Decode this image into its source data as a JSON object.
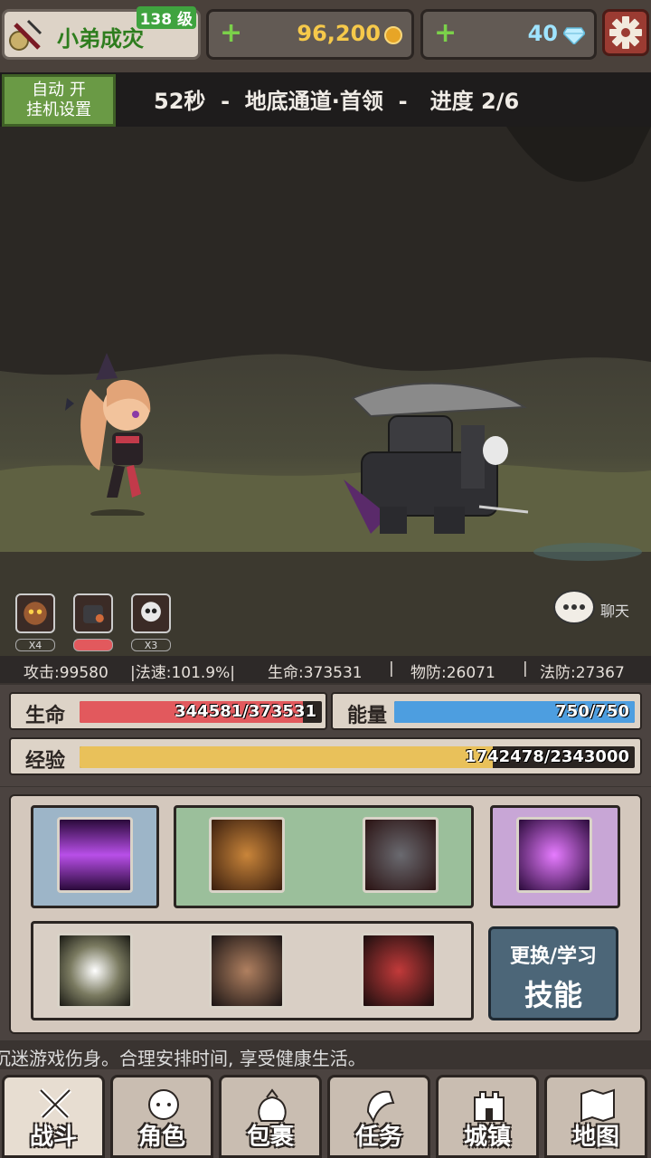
{
  "player": {
    "name": "小弟成灾",
    "level": "138 级"
  },
  "currency": {
    "gold": "96,200",
    "gems": "40",
    "plus_symbol": "+"
  },
  "auto_button": {
    "line1": "自动 开",
    "line2": "挂机设置"
  },
  "stage": {
    "text": "52秒  -  地底通道·首领  -   进度 2/6"
  },
  "enemies": [
    {
      "count": "X4"
    },
    {
      "count": ""
    },
    {
      "count": "X3"
    }
  ],
  "chat": {
    "label": "聊天"
  },
  "stats": {
    "attack": "攻击:99580",
    "cast_speed": "|法速:101.9%|",
    "hp": "生命:373531",
    "sep1": "|",
    "phys_def": "物防:26071",
    "sep2": "|",
    "mag_def": "法防:27367"
  },
  "bars": {
    "hp": {
      "label": "生命",
      "text": "344581/373531",
      "fraction": 0.9225,
      "color": "#e2595d"
    },
    "energy": {
      "label": "能量",
      "text": "750/750",
      "fraction": 1.0,
      "color": "#4d9ee0"
    },
    "exp": {
      "label": "经验",
      "text": "1742478/2343000",
      "fraction": 0.7437,
      "color": "#e9c15a"
    }
  },
  "skills": {
    "learn_line1": "更换/学习",
    "learn_line2": "技能"
  },
  "tips": {
    "text": "沉迷游戏伤身。合理安排时间, 享受健康生活。"
  },
  "nav": [
    {
      "label": "战斗"
    },
    {
      "label": "角色"
    },
    {
      "label": "包裹"
    },
    {
      "label": "任务"
    },
    {
      "label": "城镇"
    },
    {
      "label": "地图"
    }
  ]
}
